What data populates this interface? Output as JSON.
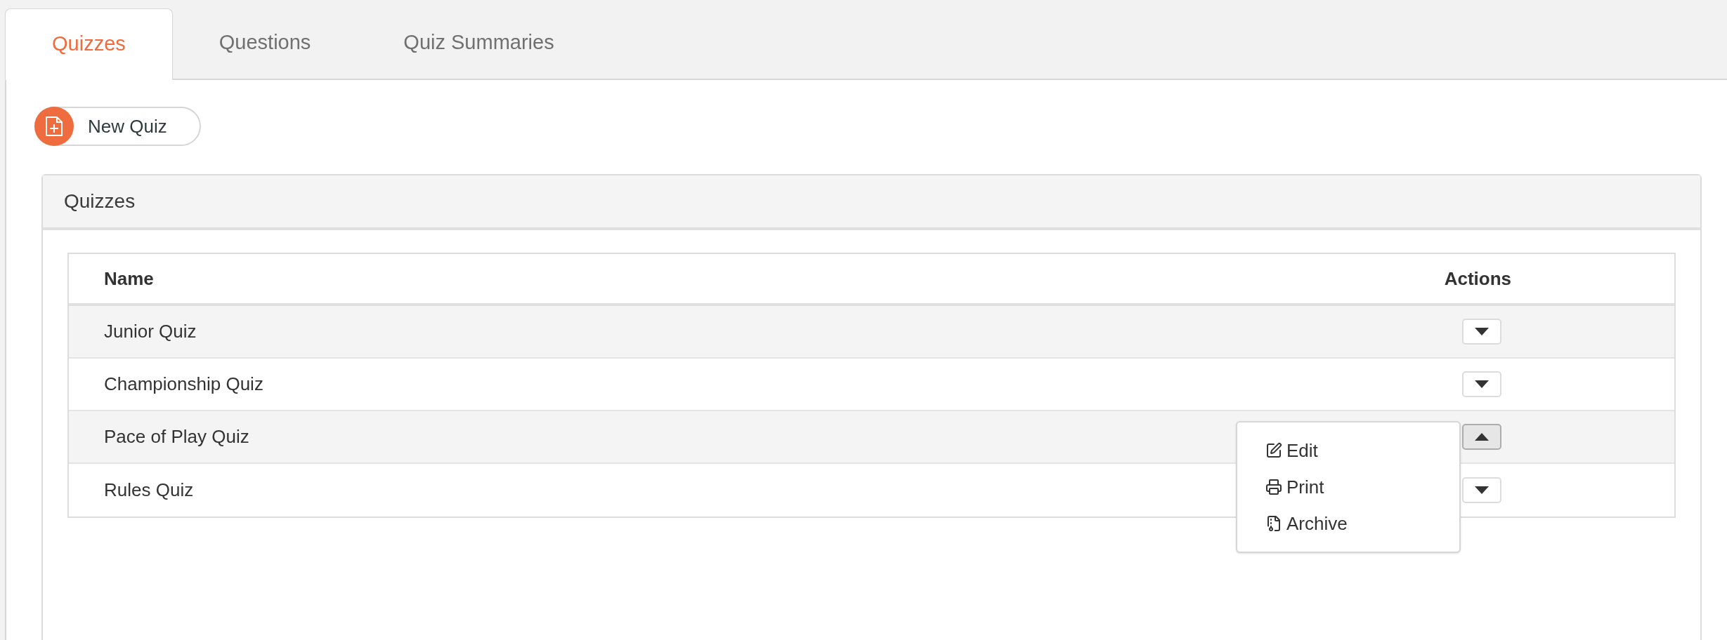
{
  "tabs": [
    {
      "label": "Quizzes",
      "selected": true
    },
    {
      "label": "Questions",
      "selected": false
    },
    {
      "label": "Quiz Summaries",
      "selected": false
    }
  ],
  "new_quiz_button": {
    "label": "New Quiz"
  },
  "panel": {
    "title": "Quizzes",
    "table": {
      "columns": [
        "Name",
        "Actions"
      ],
      "rows": [
        {
          "name": "Junior Quiz",
          "expanded": false
        },
        {
          "name": "Championship Quiz",
          "expanded": false
        },
        {
          "name": "Pace of Play Quiz",
          "expanded": true,
          "menu": [
            {
              "kind": "edit",
              "label": "Edit"
            },
            {
              "kind": "print",
              "label": "Print"
            },
            {
              "kind": "archive",
              "label": "Archive"
            }
          ]
        },
        {
          "name": "Rules Quiz",
          "expanded": false
        }
      ]
    }
  }
}
